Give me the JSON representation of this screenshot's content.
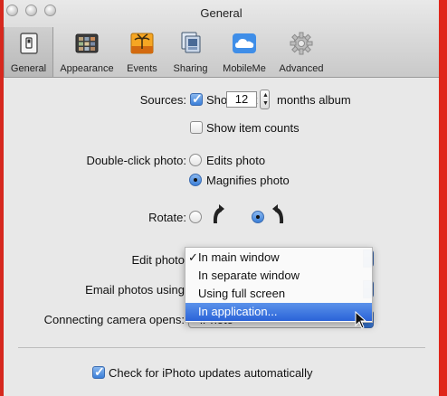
{
  "window": {
    "title": "General"
  },
  "toolbar": {
    "items": [
      {
        "label": "General",
        "icon": "switch-icon"
      },
      {
        "label": "Appearance",
        "icon": "appearance-icon"
      },
      {
        "label": "Events",
        "icon": "events-icon"
      },
      {
        "label": "Sharing",
        "icon": "sharing-icon"
      },
      {
        "label": "MobileMe",
        "icon": "mobileme-cloud-icon"
      },
      {
        "label": "Advanced",
        "icon": "gear-icon"
      }
    ]
  },
  "sources": {
    "label": "Sources:",
    "show_last_label": "Show last",
    "show_last_checked": true,
    "months_value": "12",
    "months_suffix": "months album",
    "show_item_counts_label": "Show item counts",
    "show_item_counts_checked": false
  },
  "double_click": {
    "label": "Double-click photo:",
    "options": [
      "Edits photo",
      "Magnifies photo"
    ],
    "selected": "Magnifies photo"
  },
  "rotate": {
    "label": "Rotate:",
    "selected": "clockwise"
  },
  "edit_photo": {
    "label": "Edit photo",
    "menu_options": [
      "In main window",
      "In separate window",
      "Using full screen",
      "In application..."
    ],
    "checked_option": "In main window",
    "highlighted_option": "In application..."
  },
  "email_photos": {
    "label": "Email photos using"
  },
  "connecting_camera": {
    "label": "Connecting camera opens:",
    "value": "iPhoto"
  },
  "updates": {
    "label": "Check for iPhoto updates automatically",
    "checked": true
  },
  "colors": {
    "accent": "#2a63d8",
    "desktop_red": "#d6281e"
  }
}
